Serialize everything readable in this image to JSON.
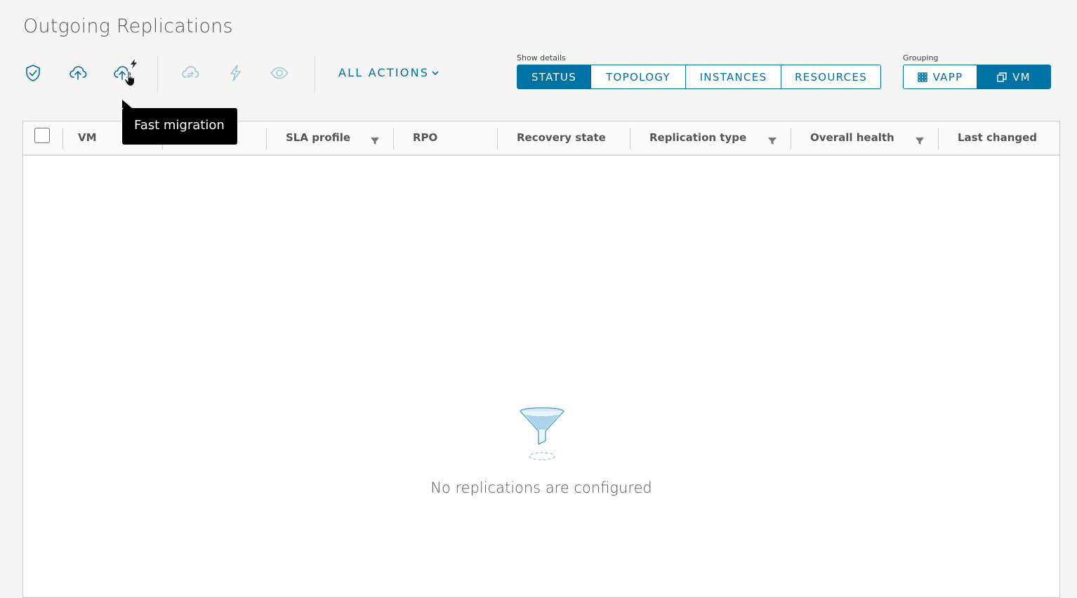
{
  "page": {
    "title": "Outgoing Replications"
  },
  "toolbar": {
    "icons": [
      {
        "name": "shield-check-icon",
        "enabled": true
      },
      {
        "name": "cloud-upload-icon",
        "enabled": true
      },
      {
        "name": "fast-migration-icon",
        "enabled": true
      },
      {
        "name": "cloud-sync-icon",
        "enabled": false
      },
      {
        "name": "lightning-icon",
        "enabled": false
      },
      {
        "name": "eye-icon",
        "enabled": false
      }
    ],
    "all_actions_label": "ALL ACTIONS",
    "tooltip": "Fast migration"
  },
  "show_details": {
    "label": "Show details",
    "options": [
      "STATUS",
      "TOPOLOGY",
      "INSTANCES",
      "RESOURCES"
    ],
    "selected": "STATUS"
  },
  "grouping": {
    "label": "Grouping",
    "options": [
      "VAPP",
      "VM"
    ],
    "selected": "VM"
  },
  "grid": {
    "columns": [
      {
        "label": "VM",
        "filter": false
      },
      {
        "label": "",
        "filter": false
      },
      {
        "label": "SLA profile",
        "filter": true
      },
      {
        "label": "RPO",
        "filter": false
      },
      {
        "label": "Recovery state",
        "filter": false
      },
      {
        "label": "Replication type",
        "filter": true
      },
      {
        "label": "Overall health",
        "filter": true
      },
      {
        "label": "Last changed",
        "filter": false
      }
    ],
    "empty_message": "No replications are configured"
  },
  "colors": {
    "accent": "#0072a3",
    "disabled_icon": "#9cc7dc",
    "background": "#f5f5f5"
  }
}
